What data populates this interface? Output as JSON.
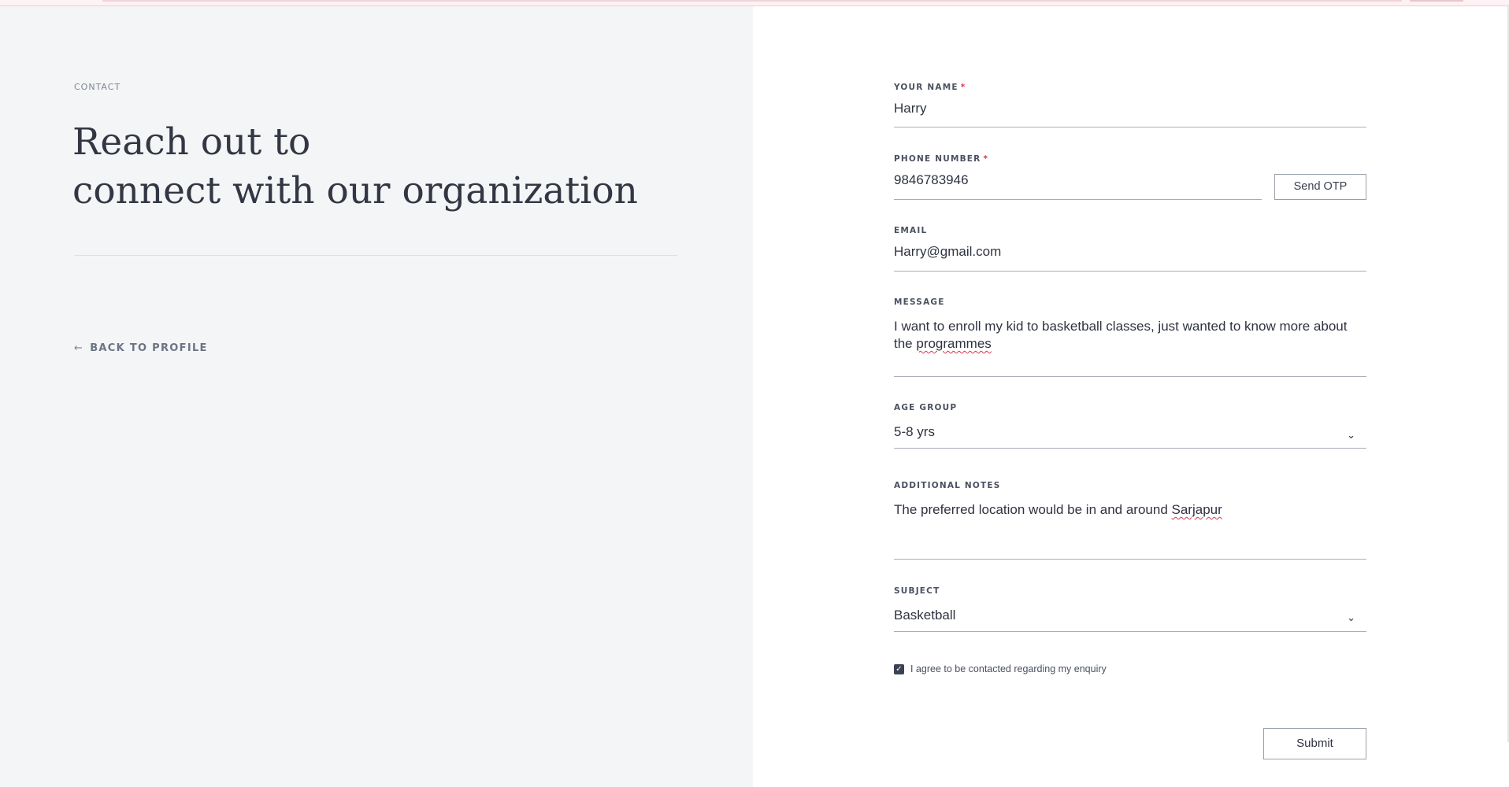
{
  "left": {
    "eyebrow": "CONTACT",
    "headline_line1": "Reach out to",
    "headline_line2": "connect with our organization",
    "back_link": "BACK TO PROFILE",
    "back_icon": "arrow-left-icon"
  },
  "form": {
    "name": {
      "label": "YOUR NAME",
      "required": "*",
      "value": "Harry"
    },
    "phone": {
      "label": "PHONE NUMBER",
      "required": "*",
      "value": "9846783946",
      "otp_button": "Send OTP"
    },
    "email": {
      "label": "EMAIL",
      "value": "Harry@gmail.com"
    },
    "message": {
      "label": "MESSAGE",
      "value_part1": "I want to enroll my kid to basketball classes, just wanted to know more about the ",
      "value_misspelled": "programmes"
    },
    "age_group": {
      "label": "AGE GROUP",
      "value": "5-8 yrs",
      "icon": "chevron-down-icon"
    },
    "notes": {
      "label": "ADDITIONAL NOTES",
      "value_part1": "The preferred location would be in and around ",
      "value_misspelled": "Sarjapur"
    },
    "subject": {
      "label": "SUBJECT",
      "value": "Basketball",
      "icon": "chevron-down-icon"
    },
    "consent": {
      "checked": true,
      "label": "I agree to be contacted regarding my enquiry"
    },
    "submit": "Submit"
  },
  "colors": {
    "left_panel_bg": "#f4f5f7",
    "text": "#2f3340",
    "required": "#d9364f",
    "checkbox": "#3a4253"
  }
}
